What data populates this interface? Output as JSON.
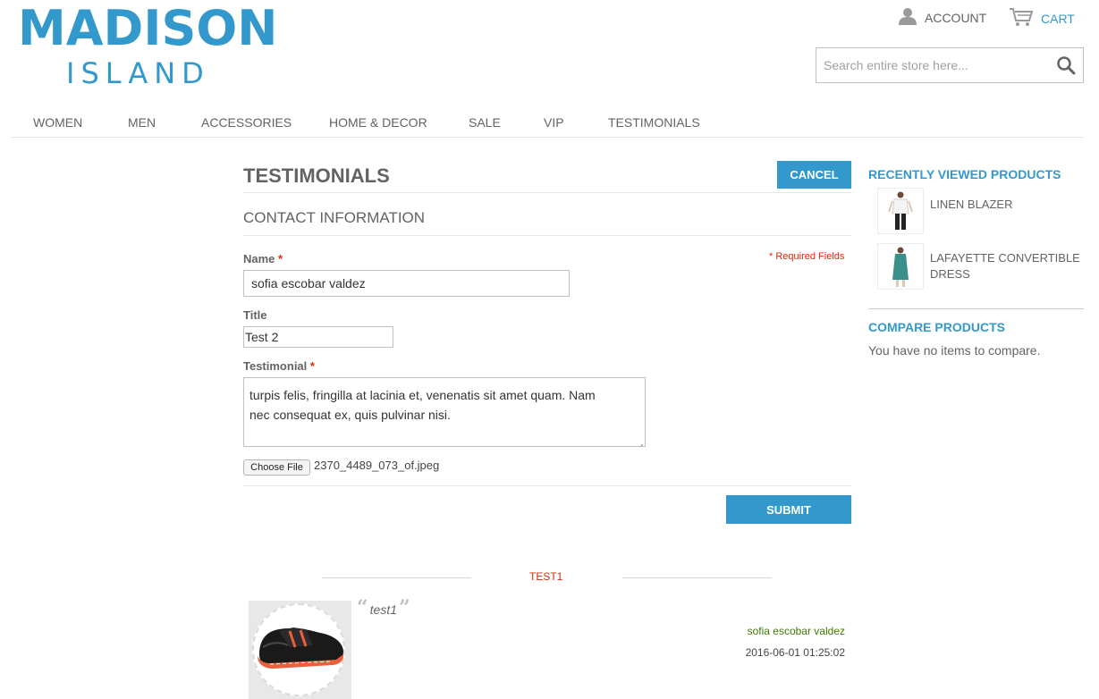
{
  "header": {
    "logo_top": "MADISON",
    "logo_bottom": "ISLAND",
    "account_label": "ACCOUNT",
    "cart_label": "CART",
    "search_placeholder": "Search entire store here..."
  },
  "nav": [
    "WOMEN",
    "MEN",
    "ACCESSORIES",
    "HOME & DECOR",
    "SALE",
    "VIP",
    "TESTIMONIALS"
  ],
  "page": {
    "title": "TESTIMONIALS",
    "cancel_label": "CANCEL",
    "section_title": "CONTACT INFORMATION",
    "required_note": "* Required Fields",
    "name_label": "Name",
    "name_value": "sofia escobar valdez",
    "title_label": "Title",
    "title_value": "Test 2",
    "testimonial_label": "Testimonial",
    "testimonial_line1": "turpis felis, fringilla at lacinia et, venenatis sit amet quam. Nam",
    "testimonial_line2": "nec consequat ex, quis pulvinar nisi.",
    "choose_file_label": "Choose File",
    "file_name": "2370_4489_073_of.jpeg",
    "submit_label": "SUBMIT",
    "required_mark": "*"
  },
  "testimonial_list": {
    "heading": "TEST1",
    "items": [
      {
        "title": "test1",
        "author": "sofia escobar valdez",
        "date": "2016-06-01 01:25:02",
        "open_quote": "“",
        "close_quote": "”"
      }
    ]
  },
  "sidebar": {
    "recently_viewed_title": "RECENTLY VIEWED PRODUCTS",
    "products": [
      {
        "name": "LINEN BLAZER"
      },
      {
        "name": "LAFAYETTE CONVERTIBLE DRESS"
      }
    ],
    "compare_title": "COMPARE PRODUCTS",
    "compare_text": "You have no items to compare."
  },
  "colors": {
    "accent": "#3399cc",
    "required": "#df280a",
    "author": "#3f7a06"
  }
}
